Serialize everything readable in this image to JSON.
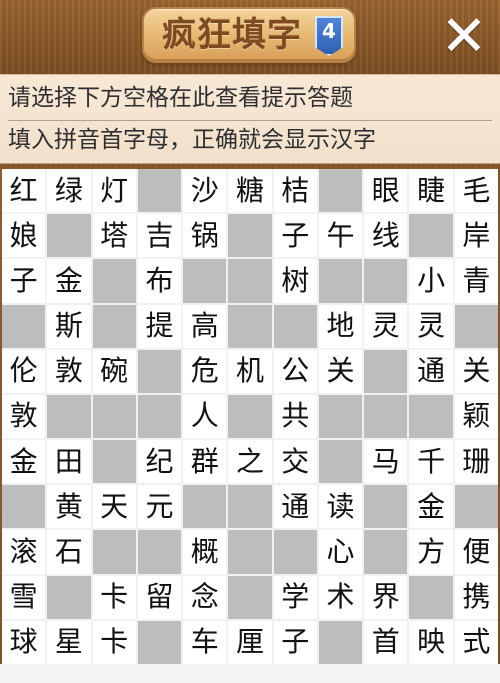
{
  "header": {
    "title": "疯狂填字",
    "version": "4",
    "close": "✕"
  },
  "hints": {
    "line1": "请选择下方空格在此查看提示答题",
    "line2": "填入拼音首字母，正确就会显示汉字"
  },
  "grid": [
    [
      "红",
      "绿",
      "灯",
      "",
      "沙",
      "糖",
      "桔",
      "",
      "眼",
      "睫",
      "毛"
    ],
    [
      "娘",
      "",
      "塔",
      "吉",
      "锅",
      "",
      "子",
      "午",
      "线",
      "",
      "岸"
    ],
    [
      "子",
      "金",
      "",
      "布",
      "",
      "",
      "树",
      "",
      "",
      "小",
      "青"
    ],
    [
      "",
      "斯",
      "",
      "提",
      "高",
      "",
      "",
      "地",
      "灵",
      "灵",
      ""
    ],
    [
      "伦",
      "敦",
      "碗",
      "",
      "危",
      "机",
      "公",
      "关",
      "",
      "通",
      "关"
    ],
    [
      "敦",
      "",
      "",
      "",
      "人",
      "",
      "共",
      "",
      "",
      "",
      "颖"
    ],
    [
      "金",
      "田",
      "",
      "纪",
      "群",
      "之",
      "交",
      "",
      "马",
      "千",
      "珊"
    ],
    [
      "",
      "黄",
      "天",
      "元",
      "",
      "",
      "通",
      "读",
      "",
      "金",
      ""
    ],
    [
      "滚",
      "石",
      "",
      "",
      "概",
      "",
      "",
      "心",
      "",
      "方",
      "便"
    ],
    [
      "雪",
      "",
      "卡",
      "留",
      "念",
      "",
      "学",
      "术",
      "界",
      "",
      "携"
    ],
    [
      "球",
      "星",
      "卡",
      "",
      "车",
      "厘",
      "子",
      "",
      "首",
      "映",
      "式"
    ]
  ]
}
